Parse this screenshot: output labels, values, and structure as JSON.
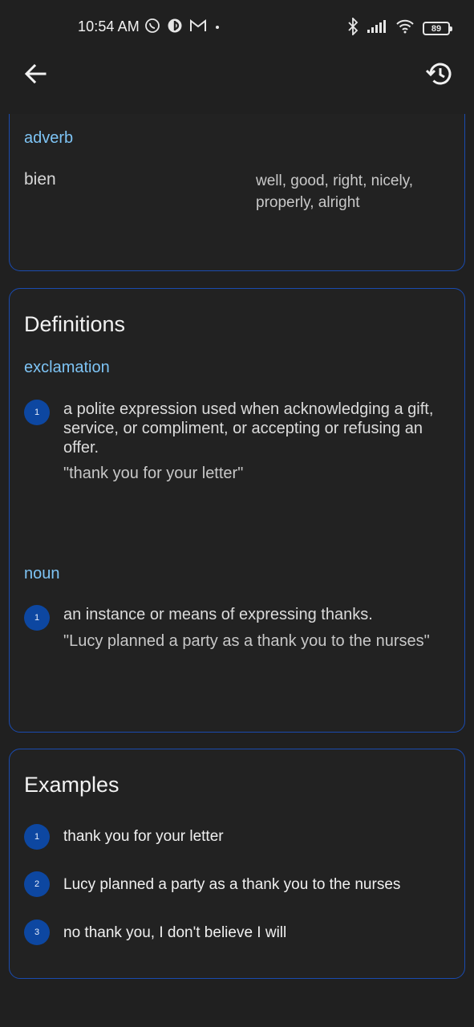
{
  "status_bar": {
    "time": "10:54 AM",
    "battery": "89",
    "left_icons": [
      "whatsapp-icon",
      "app-icon",
      "gmail-icon",
      "dot-icon"
    ],
    "right_icons": [
      "bluetooth-icon",
      "signal-icon",
      "wifi-icon",
      "battery-icon"
    ]
  },
  "app_bar": {
    "back_icon": "arrow-back-icon",
    "history_icon": "history-icon"
  },
  "translations_card": {
    "part_of_speech": "adverb",
    "word": "bien",
    "translations": "well, good, right, nicely, properly, alright"
  },
  "definitions_card": {
    "title": "Definitions",
    "groups": [
      {
        "part_of_speech": "exclamation",
        "entries": [
          {
            "number": "1",
            "definition": "a polite expression used when acknowledging a gift, service, or compliment, or accepting or refusing an offer.",
            "example": "\"thank you for your letter\""
          }
        ]
      },
      {
        "part_of_speech": "noun",
        "entries": [
          {
            "number": "1",
            "definition": "an instance or means of expressing thanks.",
            "example": "\"Lucy planned a party as a thank you to the nurses\""
          }
        ]
      }
    ]
  },
  "examples_card": {
    "title": "Examples",
    "items": [
      {
        "number": "1",
        "text": "thank you for your letter"
      },
      {
        "number": "2",
        "text": "Lucy planned a party as a thank you to the nurses"
      },
      {
        "number": "3",
        "text": "no thank you, I don't believe I will"
      }
    ]
  },
  "colors": {
    "background": "#202020",
    "card_border": "#1a4bb0",
    "accent_label": "#7ec4f5",
    "badge": "#0d47a1"
  }
}
